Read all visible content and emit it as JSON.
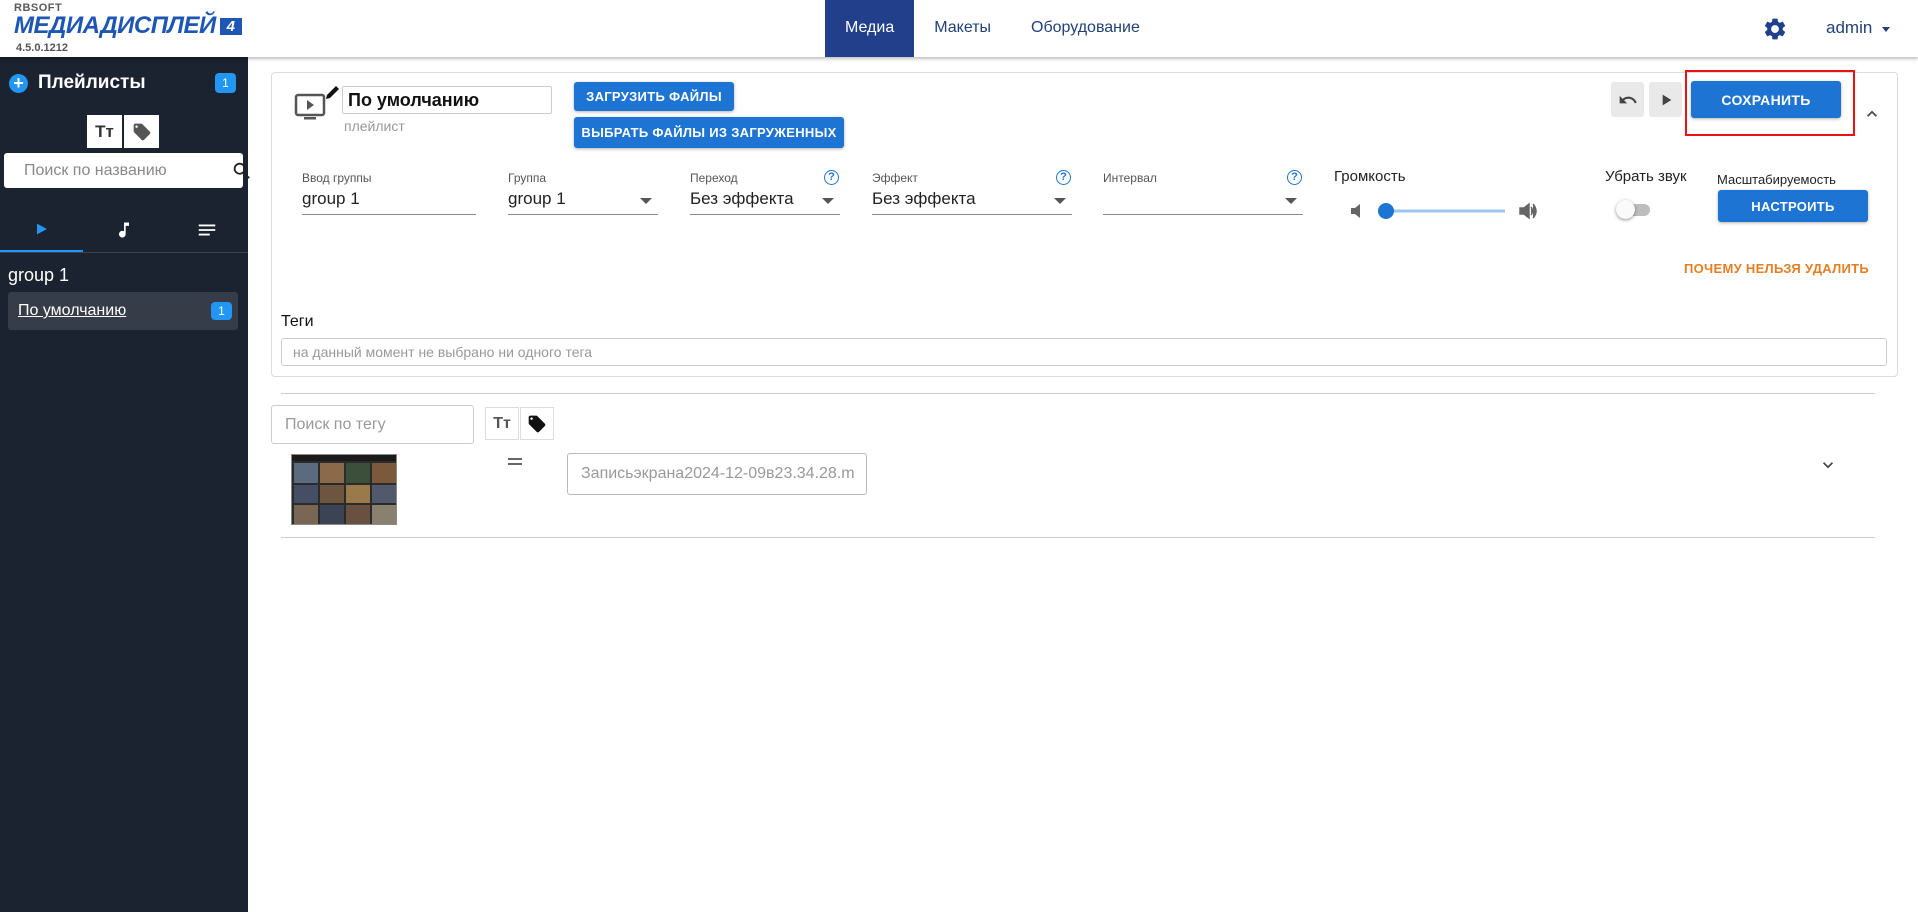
{
  "header": {
    "brand": "RBSOFT",
    "app_name": "МЕДИАДИСПЛЕЙ",
    "app_badge": "4",
    "version": "4.5.0.1212",
    "nav": [
      {
        "label": "Медиа",
        "active": true
      },
      {
        "label": "Макеты",
        "active": false
      },
      {
        "label": "Оборудование",
        "active": false
      }
    ],
    "user": "admin"
  },
  "sidebar": {
    "title": "Плейлисты",
    "count": "1",
    "tool_text": "Тт",
    "search_placeholder": "Поиск по названию",
    "group": "group 1",
    "item": {
      "label": "По умолчанию",
      "count": "1"
    }
  },
  "playlist": {
    "name": "По умолчанию",
    "subtitle": "плейлист",
    "upload_label": "ЗАГРУЗИТЬ ФАЙЛЫ",
    "choose_label": "ВЫБРАТЬ ФАЙЛЫ ИЗ ЗАГРУЖЕННЫХ",
    "save_label": "СОХРАНИТЬ",
    "fields": {
      "group_input_label": "Ввод группы",
      "group_input_value": "group 1",
      "group_label": "Группа",
      "group_value": "group 1",
      "transition_label": "Переход",
      "transition_value": "Без эффекта",
      "effect_label": "Эффект",
      "effect_value": "Без эффекта",
      "interval_label": "Интервал",
      "interval_value": ""
    },
    "volume_label": "Громкость",
    "volume_level": 0,
    "mute_label": "Убрать звук",
    "mute_on": false,
    "scale_label": "Масштабируемость",
    "config_label": "НАСТРОИТЬ",
    "why_label": "ПОЧЕМУ НЕЛЬЗЯ УДАЛИТЬ",
    "tags_label": "Теги",
    "tags_placeholder": "на данный момент не выбрано ни одного тега"
  },
  "media": {
    "tag_search_placeholder": "Поиск по тегу",
    "tool_text": "Тт",
    "file_name": "Записьэкрана2024-12-09в23.34.28.m"
  },
  "colors": {
    "accent": "#1e74d2",
    "nav_active": "#213f8a",
    "sidebar_bg": "#1b2230",
    "warning_link": "#e67e22",
    "highlight": "#e11"
  }
}
